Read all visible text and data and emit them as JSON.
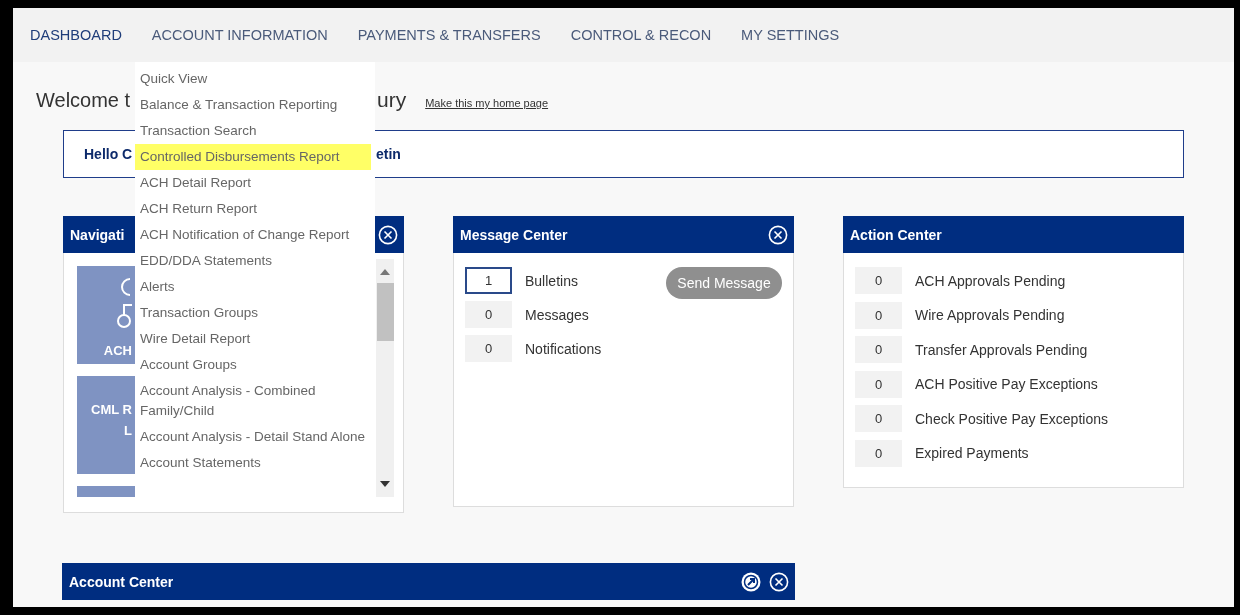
{
  "nav": {
    "tabs": [
      {
        "label": "DASHBOARD",
        "selected": true
      },
      {
        "label": "ACCOUNT INFORMATION",
        "selected": false
      },
      {
        "label": "PAYMENTS & TRANSFERS",
        "selected": false
      },
      {
        "label": "CONTROL & RECON",
        "selected": false
      },
      {
        "label": "MY SETTINGS",
        "selected": false
      }
    ]
  },
  "menu": {
    "items": [
      {
        "label": "Quick View",
        "selected": false
      },
      {
        "label": "Balance & Transaction Reporting",
        "selected": false
      },
      {
        "label": "Transaction Search",
        "selected": false
      },
      {
        "label": "Controlled Disbursements Report",
        "selected": true
      },
      {
        "label": "ACH Detail Report",
        "selected": false
      },
      {
        "label": "ACH Return Report",
        "selected": false
      },
      {
        "label": "ACH Notification of Change Report",
        "selected": false
      },
      {
        "label": "EDD/DDA Statements",
        "selected": false
      },
      {
        "label": "Alerts",
        "selected": false
      },
      {
        "label": "Transaction Groups",
        "selected": false
      },
      {
        "label": "Wire Detail Report",
        "selected": false
      },
      {
        "label": "Account Groups",
        "selected": false
      },
      {
        "label": "Account Analysis - Combined Family/Child",
        "selected": false
      },
      {
        "label": "Account Analysis - Detail Stand Alone",
        "selected": false
      },
      {
        "label": "Account Statements",
        "selected": false
      }
    ]
  },
  "welcome": {
    "title_start": "Welcome t",
    "title_end": "ury",
    "link": "Make this my home page"
  },
  "hello_box": {
    "text_start": "Hello C",
    "text_end": "etin"
  },
  "navigation_panel": {
    "title": "Navigati",
    "tiles": [
      {
        "kind": "icon",
        "label_lines": [
          "ACH"
        ]
      },
      {
        "kind": "text",
        "label_lines": [
          "CML R",
          "L"
        ]
      },
      {
        "kind": "blank"
      }
    ]
  },
  "message_center": {
    "title": "Message Center",
    "rows": [
      {
        "count": "1",
        "label": "Bulletins",
        "highlighted": true
      },
      {
        "count": "0",
        "label": "Messages",
        "highlighted": false
      },
      {
        "count": "0",
        "label": "Notifications",
        "highlighted": false
      }
    ],
    "button": {
      "label": "Send Message",
      "disabled": true
    }
  },
  "action_center": {
    "title": "Action Center",
    "rows": [
      {
        "count": "0",
        "label": "ACH Approvals Pending"
      },
      {
        "count": "0",
        "label": "Wire Approvals Pending"
      },
      {
        "count": "0",
        "label": "Transfer Approvals Pending"
      },
      {
        "count": "0",
        "label": "ACH Positive Pay Exceptions"
      },
      {
        "count": "0",
        "label": "Check Positive Pay Exceptions"
      },
      {
        "count": "0",
        "label": "Expired Payments"
      }
    ]
  },
  "account_center": {
    "title": "Account Center"
  }
}
